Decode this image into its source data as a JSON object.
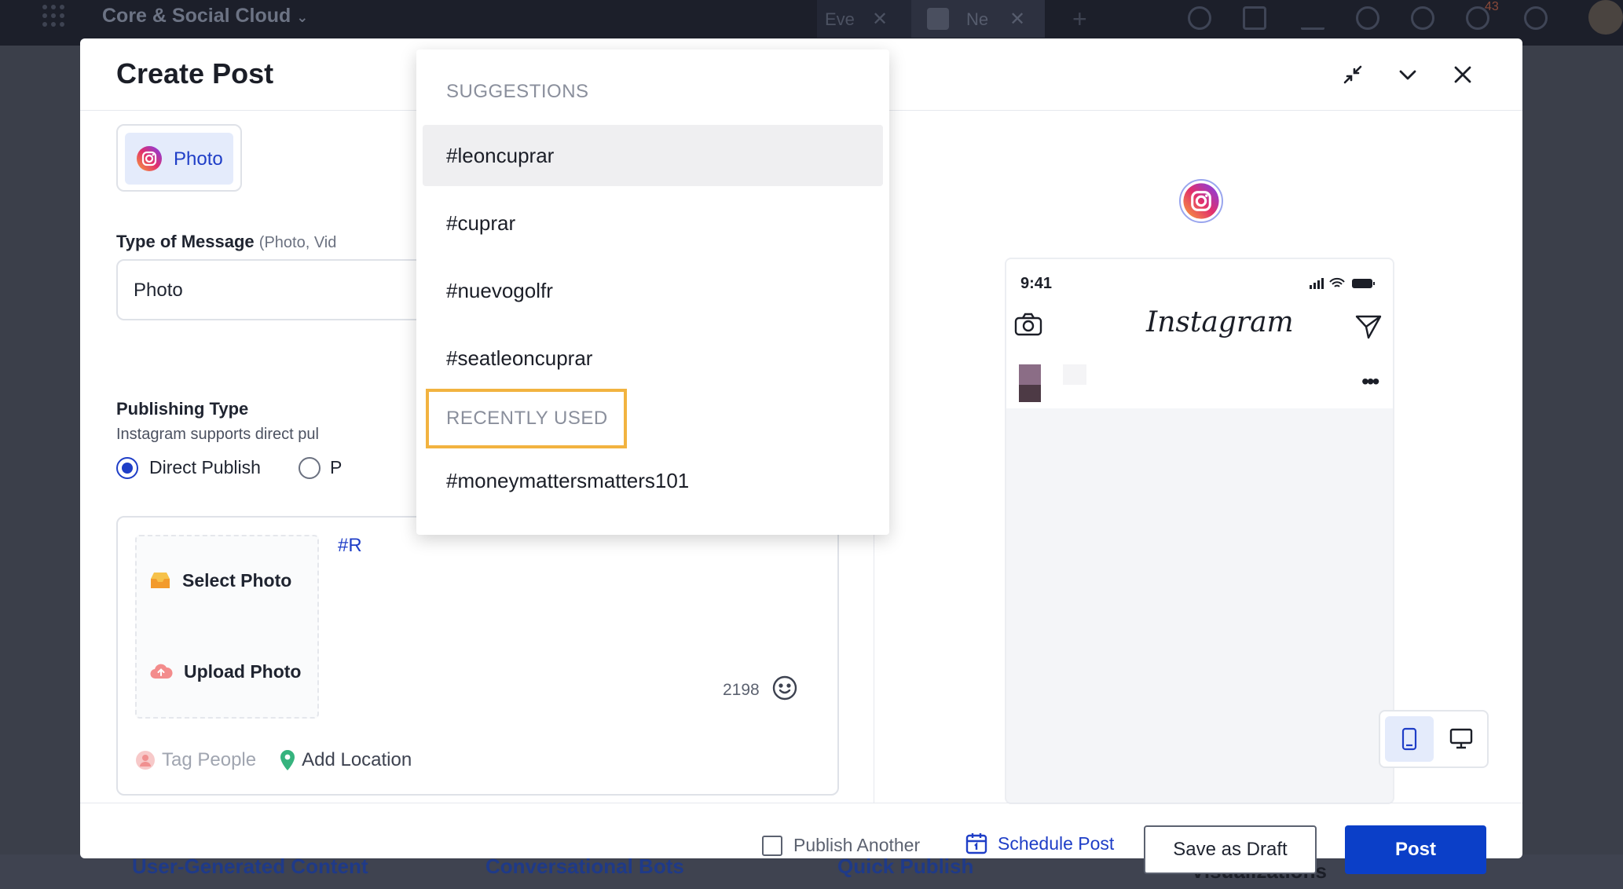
{
  "topbar": {
    "workspace_title": "Core & Social Cloud",
    "tab_a_label": "Eve",
    "tab_b_label": "Ne",
    "notification_count": "43"
  },
  "background": {
    "links": [
      "User-Generated Content",
      "Conversational Bots",
      "Quick Publish",
      "Visualizations"
    ]
  },
  "modal": {
    "title": "Create Post",
    "channel_chip": {
      "label": "Photo",
      "icon": "instagram-icon"
    },
    "type_of_message": {
      "label": "Type of Message",
      "sub": "(Photo, Vid",
      "value": "Photo"
    },
    "publishing_type": {
      "label": "Publishing Type",
      "hint": "Instagram supports direct pul",
      "options": [
        {
          "label": "Direct Publish",
          "selected": true
        },
        {
          "label": "P",
          "selected": false
        }
      ]
    },
    "composer": {
      "select_photo": "Select Photo",
      "upload_photo": "Upload Photo",
      "text": "#R",
      "char_count": "2198",
      "tag_people": "Tag People",
      "add_location": "Add Location"
    },
    "preview": {
      "time": "9:41",
      "app_name": "Instagram"
    },
    "footer": {
      "publish_another": "Publish Another",
      "schedule_post": "Schedule Post",
      "save_as_draft": "Save as Draft",
      "post": "Post"
    }
  },
  "dropdown": {
    "suggestions_heading": "SUGGESTIONS",
    "suggestions": [
      "#leoncuprar",
      "#cuprar",
      "#nuevogolfr",
      "#seatleoncuprar"
    ],
    "recent_heading": "RECENTLY USED",
    "recent": [
      "#moneymattersmatters101"
    ]
  },
  "colors": {
    "accent": "#0b3fc8",
    "link": "#1f3ec7",
    "highlight_box": "#f2b340"
  }
}
